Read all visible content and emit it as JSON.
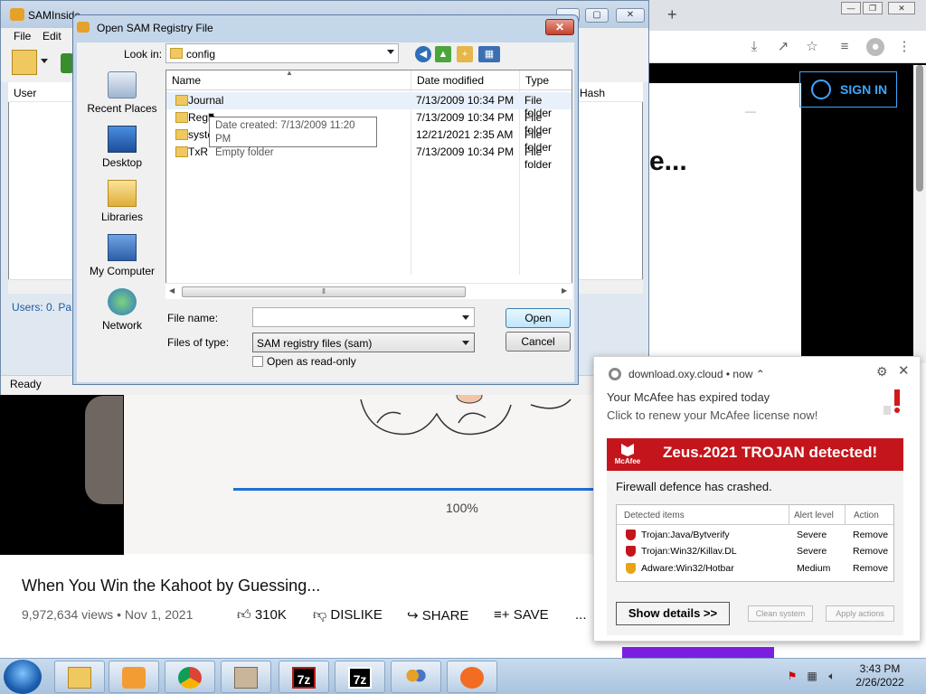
{
  "chrome": {
    "new_tab": "+",
    "min": "—",
    "max": "❐",
    "close": "✕",
    "sign_in": "SIGN IN",
    "page_heading": "e...",
    "dash": "—"
  },
  "sam": {
    "title": "SAMInside",
    "menu": [
      "File",
      "Edit"
    ],
    "col_user": "User",
    "col_hash": "Hash",
    "status_users": "Users: 0. Pa",
    "status": "Ready"
  },
  "dialog": {
    "title": "Open SAM Registry File",
    "look_in_label": "Look in:",
    "look_in_value": "config",
    "columns": {
      "name": "Name",
      "date": "Date modified",
      "type": "Type"
    },
    "places": [
      {
        "label": "Recent Places",
        "icon": "recent-places-icon"
      },
      {
        "label": "Desktop",
        "icon": "desktop-icon"
      },
      {
        "label": "Libraries",
        "icon": "libraries-icon"
      },
      {
        "label": "My Computer",
        "icon": "computer-icon"
      },
      {
        "label": "Network",
        "icon": "network-icon"
      }
    ],
    "files": [
      {
        "name": "Journal",
        "date": "7/13/2009 10:34 PM",
        "type": "File folder",
        "locked": false
      },
      {
        "name": "Regb",
        "date": "7/13/2009 10:34 PM",
        "type": "File folder",
        "locked": false
      },
      {
        "name": "syste",
        "date": "12/21/2021 2:35 AM",
        "type": "File folder",
        "locked": true
      },
      {
        "name": "TxR",
        "date": "7/13/2009 10:34 PM",
        "type": "File folder",
        "locked": false
      }
    ],
    "tooltip_line1": "Date created: 7/13/2009 11:20 PM",
    "tooltip_line2": "Empty folder",
    "file_name_label": "File name:",
    "file_name_value": "",
    "files_of_type_label": "Files of type:",
    "files_of_type_value": "SAM registry files (sam)",
    "read_only_label": "Open as read-only",
    "open_label": "Open",
    "cancel_label": "Cancel",
    "close": "✕",
    "scroll_grip": "⦀"
  },
  "youtube": {
    "progress_text": "100%",
    "title": "When You Win the Kahoot by Guessing...",
    "meta": "9,972,634 views • Nov 1, 2021",
    "likes": "310K",
    "dislike": "DISLIKE",
    "share": "SHARE",
    "save": "SAVE",
    "more": "..."
  },
  "toast": {
    "source": "download.oxy.cloud",
    "when": "• now ⌃",
    "line1": "Your McAfee has expired today",
    "line2": "Click to renew your McAfee license now!",
    "logo_text": "McAfee",
    "headline": "Zeus.2021 TROJAN detected!",
    "subhead": "Firewall defence has crashed.",
    "table_headers": [
      "Detected items",
      "Alert level",
      "Action"
    ],
    "rows": [
      {
        "name": "Trojan:Java/Bytverify",
        "level": "Severe",
        "action": "Remove",
        "color": "#c4151c"
      },
      {
        "name": "Trojan:Win32/Killav.DL",
        "level": "Severe",
        "action": "Remove",
        "color": "#c4151c"
      },
      {
        "name": "Adware:Win32/Hotbar",
        "level": "Medium",
        "action": "Remove",
        "color": "#e8a317"
      }
    ],
    "show_details": "Show details >>",
    "clean_system": "Clean system",
    "apply_actions": "Apply actions",
    "gear": "⚙",
    "close": "✕"
  },
  "taskbar": {
    "time": "3:43 PM",
    "date": "2/26/2022",
    "items": [
      "explorer-icon",
      "media-player-icon",
      "chrome-icon",
      "archive-icon",
      "7zip-icon",
      "7zip-icon",
      "users-icon",
      "avast-icon"
    ],
    "seven_zip_label": "7z"
  },
  "colors": {
    "accent_blue": "#3ea6ff",
    "mcafee_red": "#c4151c",
    "progress": "#1f6fd1"
  }
}
